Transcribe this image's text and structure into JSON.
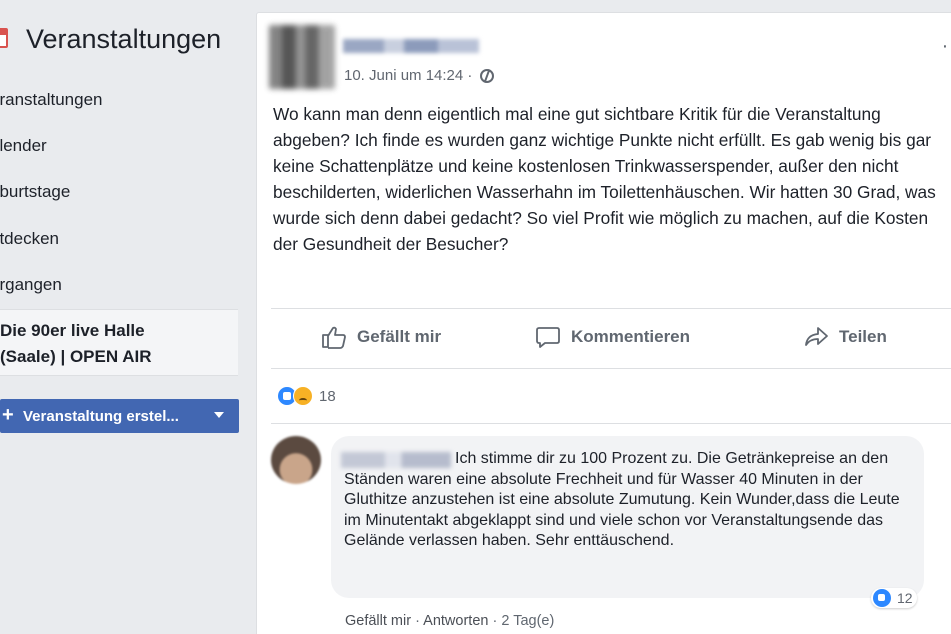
{
  "sidebar": {
    "title": "Veranstaltungen",
    "items": [
      {
        "label": "eranstaltungen"
      },
      {
        "label": "alender"
      },
      {
        "label": "eburtstage"
      },
      {
        "label": "ntdecken"
      },
      {
        "label": "ergangen"
      }
    ],
    "active_event": {
      "line1": "Die 90er live Halle",
      "line2": "(Saale) | OPEN AIR"
    },
    "create_button": "Veranstaltung erstel..."
  },
  "post": {
    "timestamp": "10. Juni um 14:24 ·",
    "more_icon": "more-dots-icon",
    "text": "Wo kann man denn eigentlich mal eine gut sichtbare Kritik für die Veranstaltung abgeben? Ich finde es wurden ganz wichtige Punkte nicht erfüllt. Es gab wenig bis gar keine Schattenplätze und keine kostenlosen Trinkwasserspender, außer den nicht beschilderten, widerlichen Wasserhahn im Toilettenhäuschen. Wir hatten 30 Grad, was wurde sich denn dabei gedacht? So viel Profit wie möglich zu machen, auf die Kosten der Gesundheit der Besucher?",
    "actions": {
      "like": "Gefällt mir",
      "comment": "Kommentieren",
      "share": "Teilen"
    },
    "reaction_count": "18"
  },
  "comment": {
    "text": "Ich stimme dir zu 100 Prozent zu. Die Getränkepreise an den Ständen waren eine absolute Frechheit und für Wasser 40 Minuten in der Gluthitze anzustehen ist eine absolute Zumutung. Kein Wunder,dass die Leute im Minutentakt abgeklappt sind und viele schon vor Veranstaltungsende das Gelände verlassen haben. Sehr enttäuschend.",
    "like_count": "12",
    "like_label": "Gefällt mir",
    "reply_label": "Antworten",
    "age": "2 Tag(e)",
    "separator": " · "
  },
  "colors": {
    "background": "#e9ebee",
    "brand_blue": "#4267b2",
    "like_blue": "#2d88ff",
    "secondary_text": "#616770"
  }
}
